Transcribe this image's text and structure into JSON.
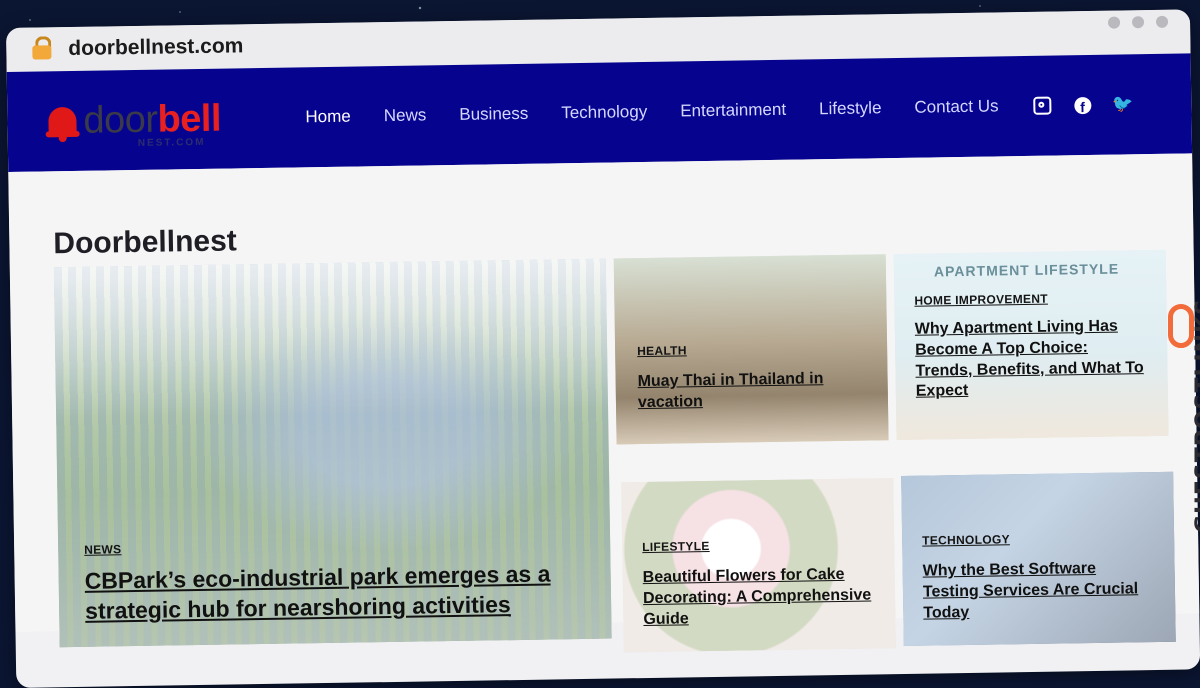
{
  "browser": {
    "url": "doorbellnest.com"
  },
  "logo": {
    "part1": "door",
    "part2": "bell",
    "subtitle": "NEST.COM"
  },
  "nav": [
    "Home",
    "News",
    "Business",
    "Technology",
    "Entertainment",
    "Lifestyle",
    "Contact Us"
  ],
  "social": [
    "instagram-icon",
    "facebook-icon",
    "twitter-icon"
  ],
  "page": {
    "title": "Doorbellnest"
  },
  "cards": [
    {
      "category": "NEWS",
      "title": "CBPark’s eco-industrial park emerges as a strategic hub for nearshoring activities"
    },
    {
      "category": "HEALTH",
      "title": "Muay Thai in Thailand in vacation"
    },
    {
      "category": "HOME IMPROVEMENT",
      "title": "Why Apartment Living Has Become A Top Choice: Trends, Benefits, and What To Expect",
      "banner": "APARTMENT LIFESTYLE"
    },
    {
      "category": "LIFESTYLE",
      "title": "Beautiful Flowers for Cake Decorating: A Comprehensive Guide"
    },
    {
      "category": "TECHNOLOGY",
      "title": "Why the Best Software Testing Services Are Crucial Today"
    }
  ],
  "watermark": {
    "text": "GUESTPOSTLINKS"
  },
  "colors": {
    "header_bg": "#06048f",
    "logo_red": "#e82020",
    "watermark_orange": "#f26b3a"
  }
}
